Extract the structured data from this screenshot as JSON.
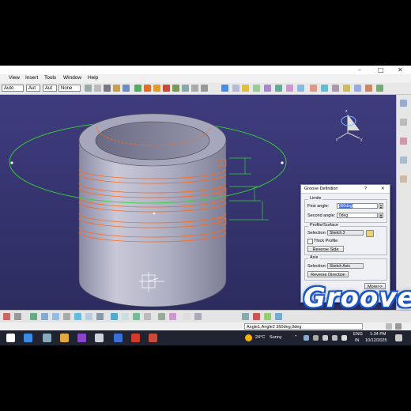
{
  "titlebar": {
    "minimize": "–",
    "maximize": "□",
    "close": "✕"
  },
  "menu": [
    "View",
    "Insert",
    "Tools",
    "Window",
    "Help"
  ],
  "toolbar": {
    "render_style": "Auto",
    "select_1": "Aut",
    "select_2": "Aut",
    "select_3": "None"
  },
  "compass": {
    "axis_labels": [
      "x",
      "y",
      "z"
    ]
  },
  "dialog": {
    "title": "Groove Definition",
    "help_label": "?",
    "close_label": "✕",
    "limits": {
      "title": "Limits",
      "first_angle_label": "First angle:",
      "first_angle_value": "360deg",
      "second_angle_label": "Second angle:",
      "second_angle_value": "0deg"
    },
    "profile": {
      "title": "Profile/Surface",
      "selection_label": "Selection:",
      "selection_value": "Sketch.3",
      "thick_profile_label": "Thick Profile",
      "reverse_side_label": "Reverse Side"
    },
    "axis": {
      "title": "Axis",
      "selection_label": "Selection:",
      "selection_value": "Sketch Axis",
      "reverse_direction_label": "Reverse Direction"
    },
    "more_label": "More>>"
  },
  "status": {
    "command_text": "Angle1,Angle2 360deg,0deg"
  },
  "taskbar": {
    "weather_temp": "24°C",
    "weather_text": "Sunny",
    "lang_line1": "ENG",
    "lang_line2": "IN",
    "time": "1:34 PM",
    "date": "10/12/2025"
  },
  "overlay": {
    "banner_text": "Groove"
  },
  "colors": {
    "viewport": "#3b3977",
    "profile_orange": "#ff6a1a",
    "axis_green": "#37d13a",
    "banner_blue": "#1a55c4"
  }
}
